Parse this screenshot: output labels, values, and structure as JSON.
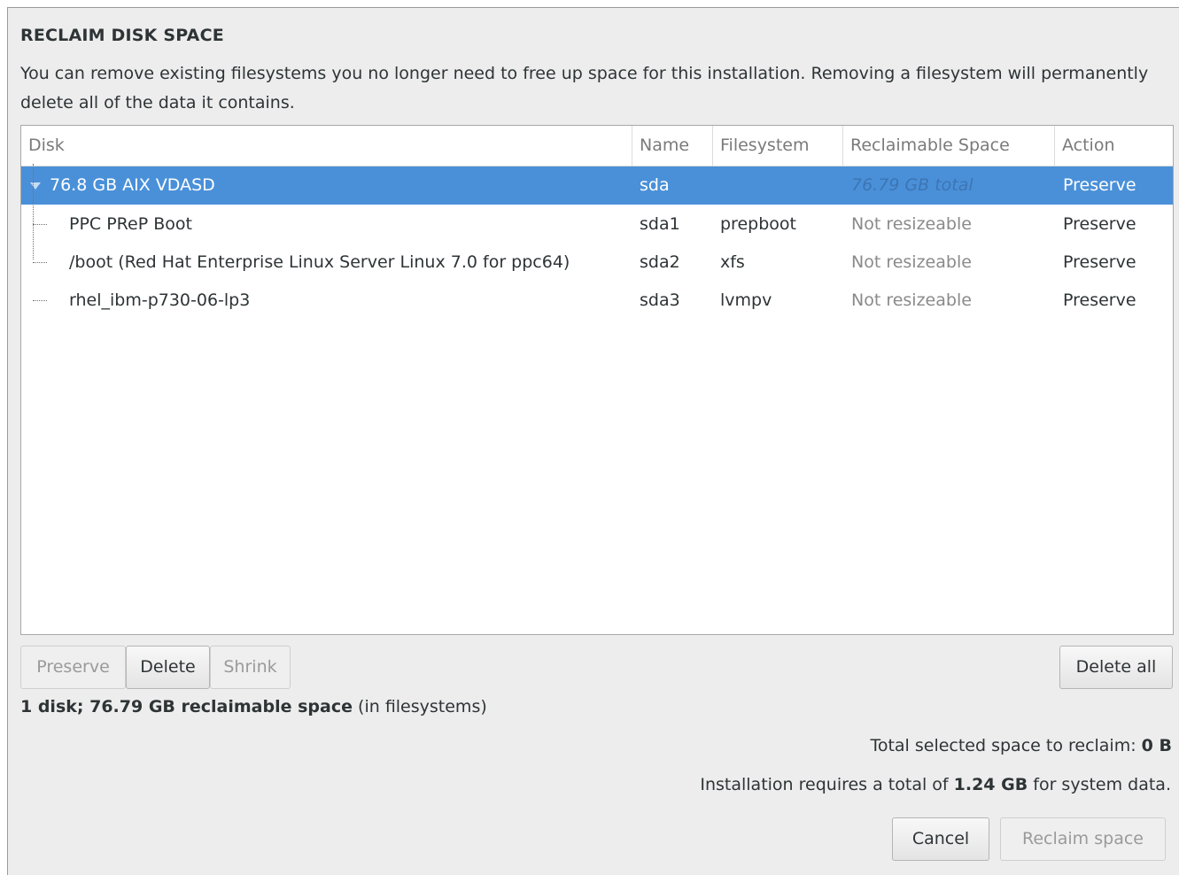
{
  "dialog": {
    "title": "RECLAIM DISK SPACE",
    "description": "You can remove existing filesystems you no longer need to free up space for this installation.  Removing a filesystem will permanently delete all of the data it contains."
  },
  "table": {
    "columns": [
      "Disk",
      "Name",
      "Filesystem",
      "Reclaimable Space",
      "Action"
    ],
    "disk": {
      "label": "76.8 GB AIX VDASD",
      "name": "sda",
      "filesystem": "",
      "reclaimable": "76.79 GB total",
      "action": "Preserve"
    },
    "partitions": [
      {
        "label": "PPC PReP Boot",
        "name": "sda1",
        "filesystem": "prepboot",
        "reclaimable": "Not resizeable",
        "action": "Preserve"
      },
      {
        "label": "/boot (Red Hat Enterprise Linux Server Linux 7.0 for ppc64)",
        "name": "sda2",
        "filesystem": "xfs",
        "reclaimable": "Not resizeable",
        "action": "Preserve"
      },
      {
        "label": "rhel_ibm-p730-06-lp3",
        "name": "sda3",
        "filesystem": "lvmpv",
        "reclaimable": "Not resizeable",
        "action": "Preserve"
      }
    ]
  },
  "buttons": {
    "preserve": "Preserve",
    "delete": "Delete",
    "shrink": "Shrink",
    "delete_all": "Delete all",
    "cancel": "Cancel",
    "reclaim": "Reclaim space"
  },
  "summary": {
    "bold": "1 disk; 76.79 GB reclaimable space",
    "rest": " (in filesystems)"
  },
  "selected": {
    "label": "Total selected space to reclaim: ",
    "value": "0 B"
  },
  "requirement": {
    "prefix": "Installation requires a total of ",
    "value": "1.24 GB",
    "suffix": " for system data."
  }
}
